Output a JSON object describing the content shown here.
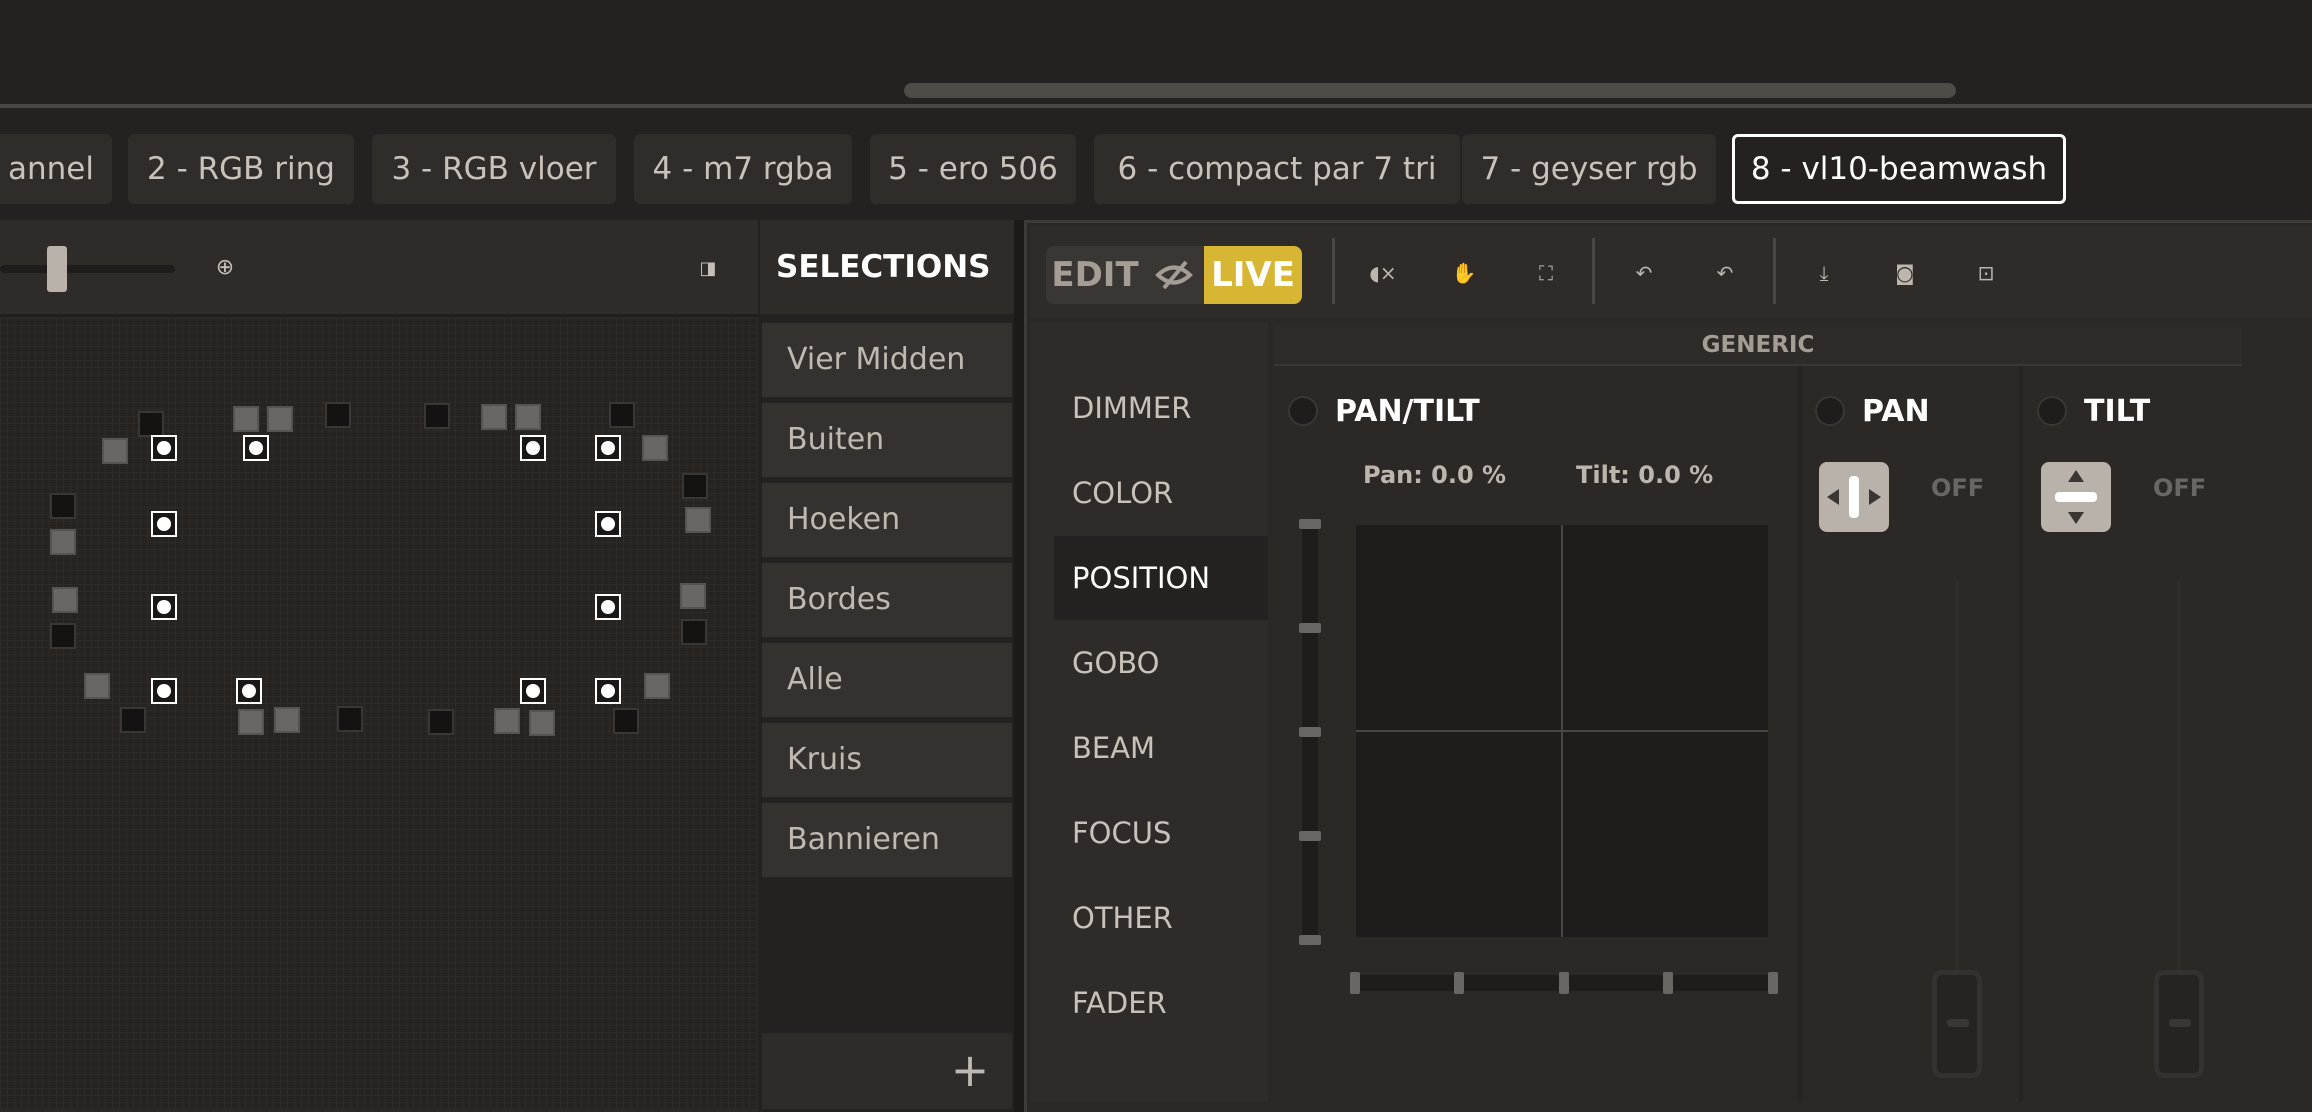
{
  "tabs": [
    {
      "label": "annel",
      "active": false
    },
    {
      "label": "2 - RGB ring",
      "active": false
    },
    {
      "label": "3 - RGB vloer",
      "active": false
    },
    {
      "label": "4 - m7 rgba",
      "active": false
    },
    {
      "label": "5 - ero 506",
      "active": false
    },
    {
      "label": "6 - compact par 7 tri",
      "active": false
    },
    {
      "label": "7 - geyser rgb",
      "active": false
    },
    {
      "label": "8 - vl10-beamwash",
      "active": true
    }
  ],
  "layout_toolbar": {
    "zoom_icon": "zoom-fit-icon",
    "panel_icon": "panel-toggle-icon"
  },
  "selections": {
    "title": "SELECTIONS",
    "items": [
      "Vier Midden",
      "Buiten",
      "Hoeken",
      "Bordes",
      "Alle",
      "Kruis",
      "Bannieren"
    ],
    "add_label": "+"
  },
  "programmer": {
    "edit_label": "EDIT",
    "live_label": "LIVE",
    "blind_icon": "eye-slash-icon",
    "tool_icons": [
      "mute-icon",
      "hand-icon",
      "select-frame-icon",
      "reset-all-icon",
      "reset-selected-icon",
      "download-icon",
      "camera-icon",
      "camera-settings-icon"
    ],
    "colors": {
      "live": "#d6b633",
      "background": "#2b2826"
    }
  },
  "categories": [
    {
      "label": "DIMMER",
      "active": false
    },
    {
      "label": "COLOR",
      "active": false
    },
    {
      "label": "POSITION",
      "active": true
    },
    {
      "label": "GOBO",
      "active": false
    },
    {
      "label": "BEAM",
      "active": false
    },
    {
      "label": "FOCUS",
      "active": false
    },
    {
      "label": "OTHER",
      "active": false
    },
    {
      "label": "FADER",
      "active": false
    }
  ],
  "generic": {
    "header": "GENERIC",
    "pantilt": {
      "title": "PAN/TILT",
      "pan_readout": "Pan: 0.0  %",
      "tilt_readout": "Tilt: 0.0  %",
      "pan_value": 0.0,
      "tilt_value": 0.0
    },
    "pan": {
      "title": "PAN",
      "state": "OFF"
    },
    "tilt": {
      "title": "TILT",
      "state": "OFF"
    }
  }
}
